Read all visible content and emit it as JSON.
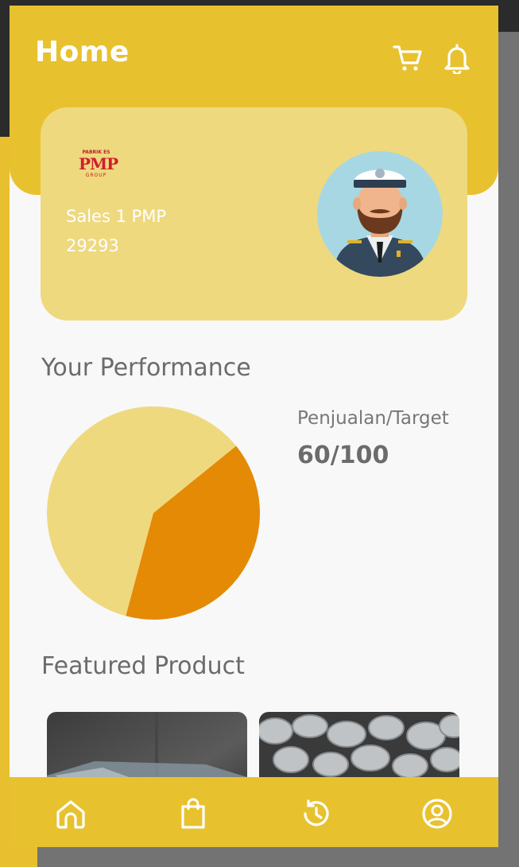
{
  "header": {
    "title": "Home",
    "icons": [
      "cart-icon",
      "bell-icon"
    ],
    "background_color": "#e8c12f"
  },
  "profile": {
    "logo_top": "PABRIK ES",
    "logo_main": "PMP",
    "logo_bottom": "GROUP",
    "name": "Sales 1 PMP",
    "id": "29293",
    "avatar": "captain-avatar",
    "card_color": "#eed97f"
  },
  "performance": {
    "title": "Your Performance",
    "ratio_label": "Penjualan/Target",
    "ratio_value": "60/100"
  },
  "featured": {
    "title": "Featured Product",
    "products": [
      {
        "image": "ice-block-image"
      },
      {
        "image": "ice-cubes-image"
      }
    ]
  },
  "bottom_nav": {
    "items": [
      "home-icon",
      "shopping-bag-icon",
      "history-icon",
      "profile-icon"
    ]
  },
  "chart_data": {
    "type": "pie",
    "title": "",
    "slices": [
      {
        "value": 60,
        "color": "#efd97f"
      },
      {
        "value": 40,
        "color": "#e48a04"
      }
    ]
  }
}
